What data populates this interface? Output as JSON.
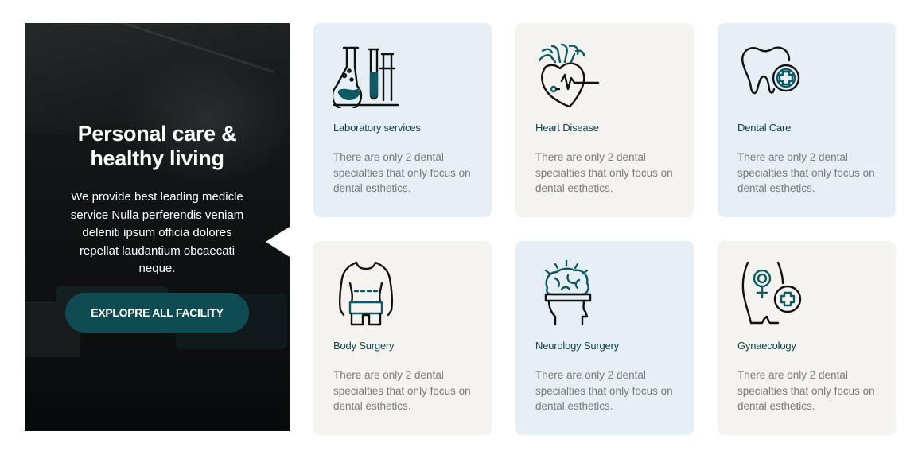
{
  "hero": {
    "title": "Personal care & healthy living",
    "text": "We provide best leading medicle service Nulla perferendis veniam deleniti ipsum officia dolores repellat laudantium obcaecati neque.",
    "button_label": "EXPLOPRE ALL FACILITY"
  },
  "colors": {
    "accent": "#0e4b52",
    "card_blue": "#e6eff5",
    "card_beige": "#f4f3ef",
    "title_text": "#0d3f49"
  },
  "services": [
    {
      "title": "Laboratory services",
      "desc": "There are only 2 dental specialties that only focus on dental esthetics.",
      "icon": "laboratory-flask-icon"
    },
    {
      "title": "Heart Disease",
      "desc": "There are only 2 dental specialties that only focus on dental esthetics.",
      "icon": "heart-icon"
    },
    {
      "title": "Dental Care",
      "desc": "There are only 2 dental specialties that only focus on dental esthetics.",
      "icon": "tooth-icon"
    },
    {
      "title": "Body Surgery",
      "desc": "There are only 2 dental specialties that only focus on dental esthetics.",
      "icon": "body-icon"
    },
    {
      "title": "Neurology Surgery",
      "desc": "There are only 2 dental specialties that only focus on dental esthetics.",
      "icon": "brain-icon"
    },
    {
      "title": "Gynaecology",
      "desc": "There are only 2 dental specialties that only focus on dental esthetics.",
      "icon": "female-symbol-icon"
    }
  ]
}
